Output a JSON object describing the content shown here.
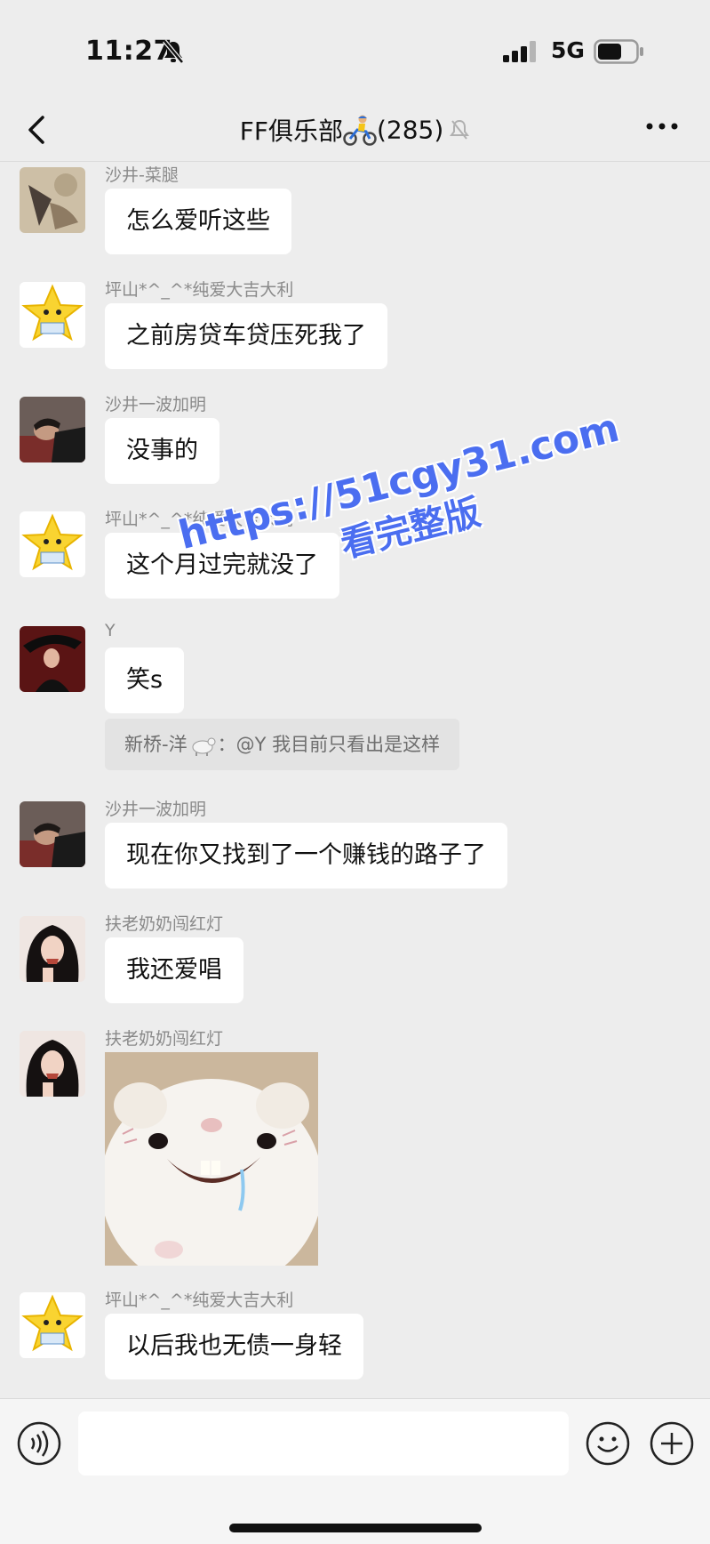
{
  "status_bar": {
    "time": "11:27",
    "network": "5G"
  },
  "header": {
    "title": "FF俱乐部",
    "count": "(285)"
  },
  "messages": [
    {
      "sender": "沙井-菜腿",
      "text": "怎么爱听这些"
    },
    {
      "sender": "坪山*^_^*纯爱大吉大利",
      "text": "之前房贷车贷压死我了"
    },
    {
      "sender": "沙井一波加明",
      "text": "没事的"
    },
    {
      "sender": "坪山*^_^*纯爱大吉大利",
      "text": "这个月过完就没了"
    },
    {
      "sender": "Y",
      "text": "笑s"
    },
    {
      "sender": "沙井一波加明",
      "text": "现在你又找到了一个赚钱的路子了"
    },
    {
      "sender": "扶老奶奶闯红灯",
      "text": "我还爱唱"
    },
    {
      "sender": "扶老奶奶闯红灯",
      "text": ""
    },
    {
      "sender": "坪山*^_^*纯爱大吉大利",
      "text": "以后我也无债一身轻"
    }
  ],
  "quote": {
    "author": "新桥-洋",
    "text": "@Y 我目前只看出是这样"
  },
  "watermark": {
    "url": "https://51cgy31.com",
    "subtitle": "看完整版"
  },
  "input": {
    "value": "",
    "placeholder": ""
  },
  "colors": {
    "background": "#ededed",
    "bubble": "#ffffff",
    "watermark": "#4b6ef0",
    "sender": "#8a8a8a"
  },
  "icons": [
    "mute-bell-icon",
    "signal-icon",
    "battery-icon",
    "back-icon",
    "bike-emoji-icon",
    "muted-group-icon",
    "more-icon",
    "voice-icon",
    "emoji-icon",
    "plus-icon",
    "goat-emoji-icon"
  ]
}
